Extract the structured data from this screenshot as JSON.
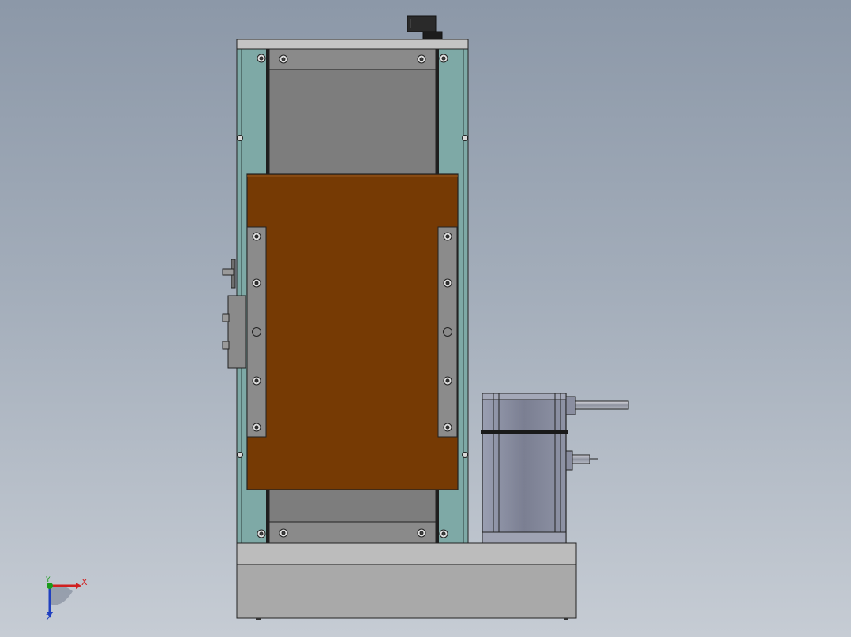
{
  "viewport": {
    "background_top": "#8c98a8",
    "background_bottom": "#c6ccd4"
  },
  "colors": {
    "teal_side_rail": "#7ea9a6",
    "carriage_plate": "#763a04",
    "gray_cover": "#7d7d7d",
    "motor_body": "#7b7f92",
    "base_block": "#a9a9a9",
    "triad_x": "#d02020",
    "triad_y": "#1a9a1a",
    "triad_z": "#2040c0"
  },
  "triad": {
    "x_label": "X",
    "y_label": "Y",
    "z_label": "Z"
  },
  "model_parts": [
    "linear-module-frame",
    "carriage-plate",
    "guide-blocks",
    "servo-motor",
    "base-block",
    "top-connector"
  ]
}
